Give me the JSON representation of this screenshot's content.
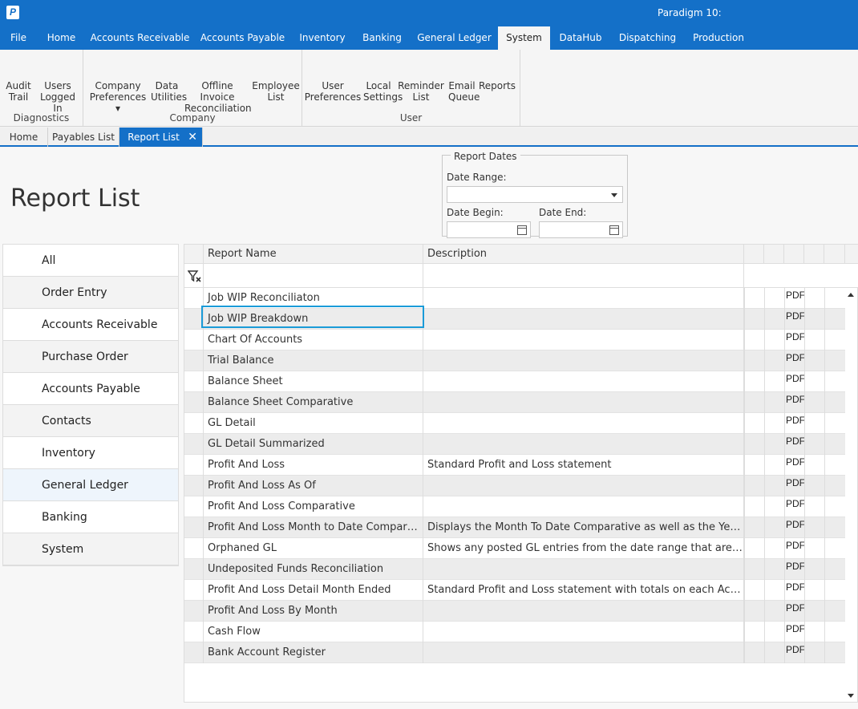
{
  "app": {
    "logo": "P",
    "title": "Paradigm 10:"
  },
  "menu": [
    {
      "label": "File"
    },
    {
      "label": "Home"
    },
    {
      "label": "Accounts Receivable"
    },
    {
      "label": "Accounts Payable"
    },
    {
      "label": "Inventory"
    },
    {
      "label": "Banking"
    },
    {
      "label": "General Ledger"
    },
    {
      "label": "System",
      "active": true
    },
    {
      "label": "DataHub"
    },
    {
      "label": "Dispatching"
    },
    {
      "label": "Production"
    }
  ],
  "ribbon": {
    "groups": [
      {
        "label": "Diagnostics",
        "buttons": [
          {
            "label": "Audit\nTrail",
            "icon": "clipboard-clock-icon"
          },
          {
            "label": "Users\nLogged In",
            "icon": "users-icon"
          }
        ]
      },
      {
        "label": "Company",
        "buttons": [
          {
            "label": "Company\nPreferences ▾",
            "icon": "gear-icon"
          },
          {
            "label": "Data\nUtilities",
            "icon": "tools-icon"
          },
          {
            "label": "Offline Invoice\nReconciliation",
            "icon": "checklist-icon"
          },
          {
            "label": "Employee\nList",
            "icon": "person-icon"
          }
        ]
      },
      {
        "label": "User",
        "buttons": [
          {
            "label": "User\nPreferences",
            "icon": "gear-icon"
          },
          {
            "label": "Local\nSettings",
            "icon": "gear-icon"
          },
          {
            "label": "Reminder\nList",
            "icon": "calendar-clock-icon"
          },
          {
            "label": "Email\nQueue",
            "icon": "email-queue-icon"
          },
          {
            "label": "Reports",
            "icon": "report-icon"
          }
        ]
      }
    ]
  },
  "doc_tabs": [
    {
      "label": "Home"
    },
    {
      "label": "Payables List"
    },
    {
      "label": "Report List",
      "active": true,
      "close": "✕"
    }
  ],
  "page_title": "Report List",
  "report_dates": {
    "legend": "Report Dates",
    "date_range_label": "Date Range:",
    "date_range_value": "",
    "date_begin_label": "Date Begin:",
    "date_begin_value": "",
    "date_end_label": "Date End:",
    "date_end_value": ""
  },
  "sidebar": [
    {
      "label": "All",
      "icon": "all-icon"
    },
    {
      "label": "Order Entry",
      "icon": "order-entry-icon"
    },
    {
      "label": "Accounts Receivable",
      "icon": "money-icon"
    },
    {
      "label": "Purchase Order",
      "icon": "purchase-order-icon"
    },
    {
      "label": "Accounts Payable",
      "icon": "money-icon"
    },
    {
      "label": "Contacts",
      "icon": "contacts-icon"
    },
    {
      "label": "Inventory",
      "icon": "barcode-icon"
    },
    {
      "label": "General Ledger",
      "icon": "ledger-icon",
      "selected": true
    },
    {
      "label": "Banking",
      "icon": "bank-icon"
    },
    {
      "label": "System",
      "icon": "gear-icon"
    }
  ],
  "grid": {
    "columns": [
      "Report Name",
      "Description"
    ],
    "actions": [
      "excel-icon",
      "word-icon",
      "pdf-icon",
      "preview-icon",
      "print-icon"
    ],
    "rows": [
      {
        "name": "Job WIP Reconciliaton",
        "description": ""
      },
      {
        "name": "Job WIP Breakdown",
        "description": ""
      },
      {
        "name": "Chart Of Accounts",
        "description": ""
      },
      {
        "name": "Trial Balance",
        "description": ""
      },
      {
        "name": "Balance Sheet",
        "description": ""
      },
      {
        "name": "Balance Sheet Comparative",
        "description": ""
      },
      {
        "name": "GL Detail",
        "description": ""
      },
      {
        "name": "GL Detail Summarized",
        "description": ""
      },
      {
        "name": "Profit And Loss",
        "description": "Standard Profit and Loss statement"
      },
      {
        "name": "Profit And Loss As Of",
        "description": ""
      },
      {
        "name": "Profit And Loss Comparative",
        "description": ""
      },
      {
        "name": "Profit And Loss Month to Date Comparat...",
        "description": "Displays the Month To Date Comparative as well as the Year t..."
      },
      {
        "name": "Orphaned GL",
        "description": "Shows any posted GL entries from the date range that are no..."
      },
      {
        "name": "Undeposited Funds Reconciliation",
        "description": ""
      },
      {
        "name": "Profit And Loss Detail Month Ended",
        "description": "Standard Profit and Loss statement with totals on each Accou..."
      },
      {
        "name": "Profit And Loss By Month",
        "description": ""
      },
      {
        "name": "Cash Flow",
        "description": ""
      },
      {
        "name": "Bank Account Register",
        "description": ""
      }
    ]
  },
  "colors": {
    "brand": "#1470c8",
    "selection": "#1a9bd8",
    "print": "#3b6fd8"
  }
}
